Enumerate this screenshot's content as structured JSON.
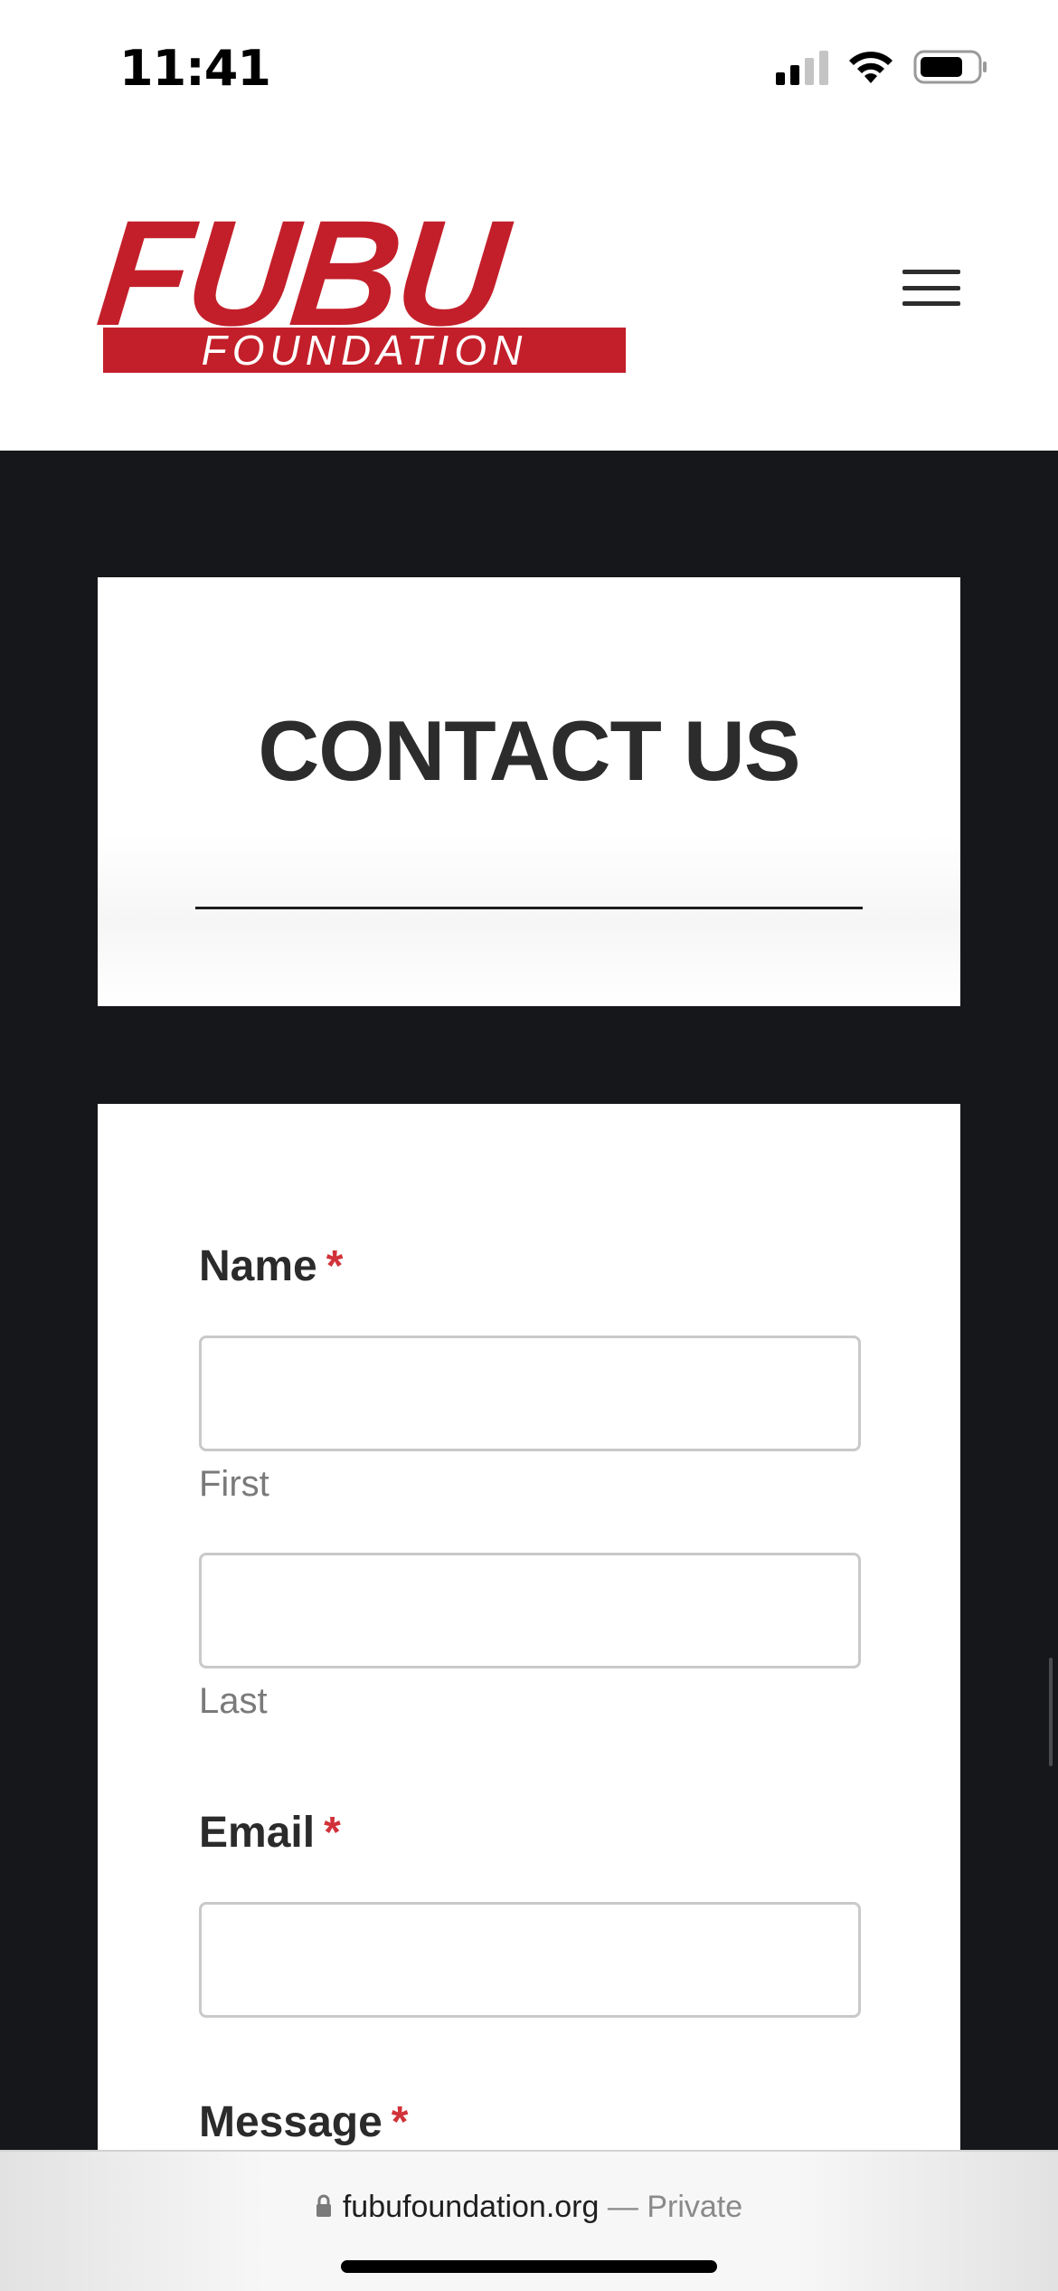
{
  "status_bar": {
    "time": "11:41"
  },
  "header": {
    "logo_top": "FUBU",
    "logo_bottom": "FOUNDATION",
    "brand_color": "#c31f2a",
    "menu_icon": "hamburger-menu-icon"
  },
  "contact": {
    "title": "CONTACT US"
  },
  "form": {
    "name_label": "Name",
    "email_label": "Email",
    "message_label": "Message",
    "required_mark": "*",
    "first_sublabel": "First",
    "last_sublabel": "Last",
    "first_value": "",
    "last_value": "",
    "email_value": ""
  },
  "browser": {
    "domain": "fubufoundation.org",
    "separator": " — ",
    "privacy": "Private"
  }
}
